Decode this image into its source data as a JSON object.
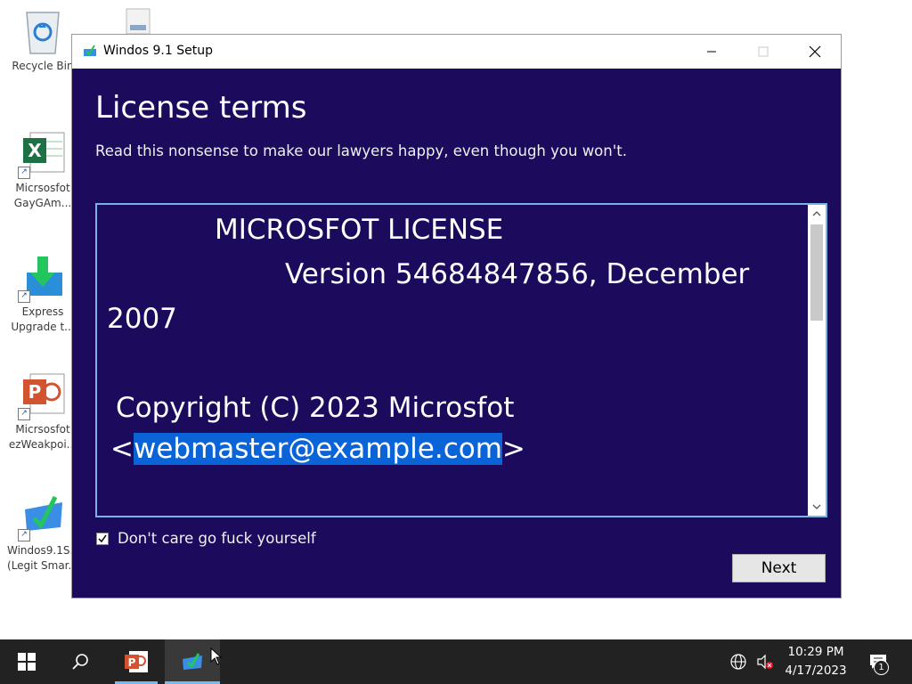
{
  "desktop": {
    "icons": [
      {
        "label1": "Recycle Bin",
        "label2": ""
      },
      {
        "label1": "Micrsosfot",
        "label2": "GayGAm..."
      },
      {
        "label1": "Express",
        "label2": "Upgrade t..."
      },
      {
        "label1": "Micrsosfot",
        "label2": "ezWeakpoi..."
      },
      {
        "label1": "Windos9.1S...",
        "label2": "(Legit Smar..."
      }
    ]
  },
  "window": {
    "title": "Windos 9.1 Setup",
    "heading": "License terms",
    "subheading": "Read this nonsense to make our lawyers happy, even though you won't.",
    "license": {
      "line1": "MICROSFOT LICENSE",
      "line2": "Version 54684847856, December",
      "line3": "2007",
      "line4": "Copyright (C) 2023 Microsfot",
      "email_open": "<",
      "email": "webmaster@example.com",
      "email_close": ">"
    },
    "checkbox": {
      "label": "Don't care go fuck yourself",
      "checked": true
    },
    "next_label": "Next"
  },
  "taskbar": {
    "time": "10:29 PM",
    "date": "4/17/2023",
    "notification_count": "1"
  },
  "colors": {
    "window_bg": "#1c0a5c",
    "selection": "#0a64d8",
    "taskbar_bg": "#222222",
    "accent": "#76b9ed"
  }
}
